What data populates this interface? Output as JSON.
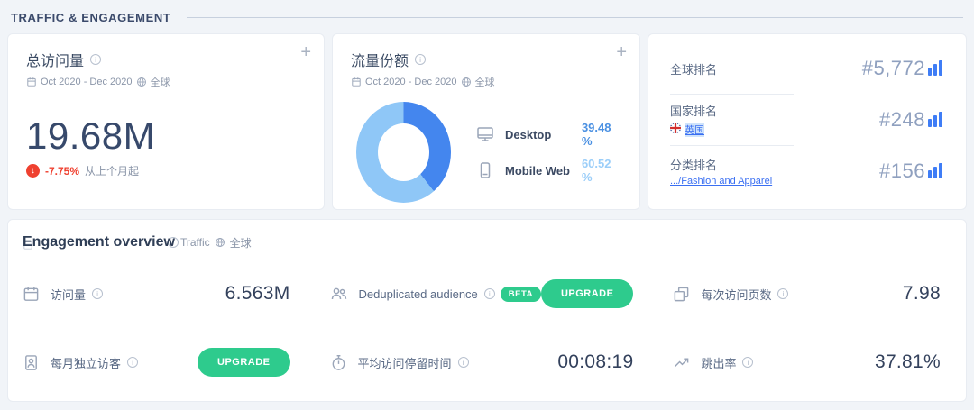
{
  "page": {
    "section_title": "TRAFFIC & ENGAGEMENT"
  },
  "colors": {
    "desktop_blue": "#4486ee",
    "mobile_blue": "#8fc7f7",
    "green": "#2ecb8d",
    "red": "#ef4130",
    "navy": "#37496b",
    "rank_bar_blue": "#3f7df6"
  },
  "cards": {
    "total_visits": {
      "title": "总访问量",
      "date_range": "Oct 2020 - Dec 2020",
      "region": "全球",
      "value": "19.68M",
      "change": "-7.75%",
      "change_note": "从上个月起"
    },
    "traffic_share": {
      "title": "流量份额",
      "date_range": "Oct 2020 - Dec 2020",
      "region": "全球",
      "legend": [
        {
          "label": "Desktop",
          "value": "39.48 %"
        },
        {
          "label": "Mobile Web",
          "value": "60.52 %"
        }
      ]
    },
    "rankings": {
      "rows": [
        {
          "label": "全球排名",
          "value": "#5,772"
        },
        {
          "label": "国家排名",
          "country": "英国",
          "value": "#248"
        },
        {
          "label": "分类排名",
          "category": ".../Fashion and Apparel",
          "value": "#156"
        }
      ]
    }
  },
  "engagement": {
    "title": "Engagement overview",
    "subtitle_traffic": "Traffic",
    "subtitle_region": "全球",
    "metrics": [
      {
        "label": "访问量",
        "value": "6.563M"
      },
      {
        "label": "Deduplicated audience",
        "badge": "BETA",
        "action": "UPGRADE"
      },
      {
        "label": "每次访问页数",
        "value": "7.98"
      },
      {
        "label": "每月独立访客",
        "action": "UPGRADE"
      },
      {
        "label": "平均访问停留时间",
        "value": "00:08:19"
      },
      {
        "label": "跳出率",
        "value": "37.81%"
      }
    ]
  },
  "chart_data": {
    "type": "pie",
    "title": "流量份额",
    "labels": [
      "Desktop",
      "Mobile Web"
    ],
    "values": [
      39.48,
      60.52
    ],
    "colors": [
      "#4486ee",
      "#8fc7f7"
    ],
    "hole": true,
    "legend_position": "right"
  }
}
